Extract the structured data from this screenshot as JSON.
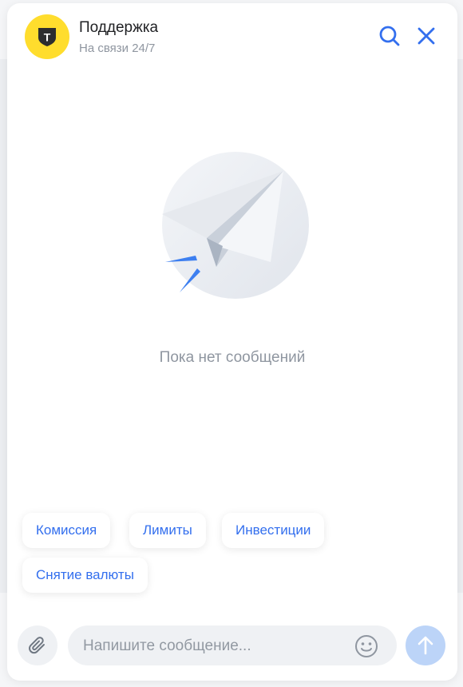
{
  "header": {
    "title": "Поддержка",
    "subtitle": "На связи 24/7",
    "logo_letter": "Т",
    "brand_color": "#ffdd2d",
    "accent_color": "#336fee",
    "icons": [
      "search-icon",
      "close-icon"
    ]
  },
  "empty_state": {
    "text": "Пока нет сообщений",
    "illustration": "paper-plane"
  },
  "quick_replies": [
    {
      "label": "Комиссия"
    },
    {
      "label": "Лимиты"
    },
    {
      "label": "Инвестиции"
    },
    {
      "label": "Снятие валюты"
    }
  ],
  "composer": {
    "placeholder": "Напишите сообщение...",
    "value": "",
    "icons": [
      "paperclip-icon",
      "emoji-icon",
      "send-arrow-icon"
    ]
  }
}
